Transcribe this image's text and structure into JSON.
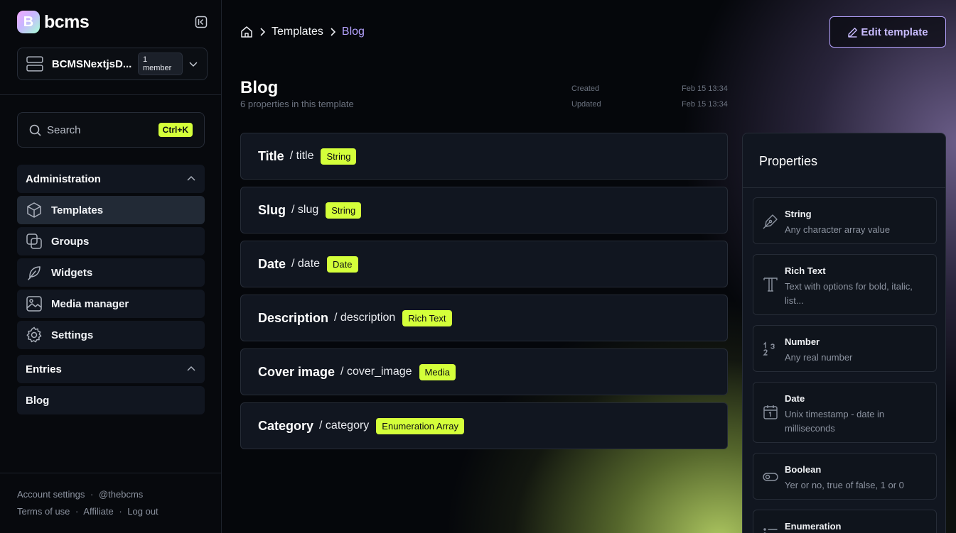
{
  "brand": {
    "name": "bcms",
    "logo_letter": "B"
  },
  "workspace": {
    "name": "BCMSNextjsD...",
    "members": "1 member"
  },
  "search": {
    "label": "Search",
    "shortcut": "Ctrl+K"
  },
  "sidebar": {
    "administration_label": "Administration",
    "admin_items": [
      {
        "label": "Templates",
        "icon": "cube-icon",
        "active": true
      },
      {
        "label": "Groups",
        "icon": "groups-icon",
        "active": false
      },
      {
        "label": "Widgets",
        "icon": "feather-icon",
        "active": false
      },
      {
        "label": "Media manager",
        "icon": "image-icon",
        "active": false
      },
      {
        "label": "Settings",
        "icon": "gear-icon",
        "active": false
      }
    ],
    "entries_label": "Entries",
    "entries_items": [
      {
        "label": "Blog"
      }
    ]
  },
  "footer": {
    "account_settings": "Account settings",
    "handle": "@thebcms",
    "terms": "Terms of use",
    "affiliate": "Affiliate",
    "logout": "Log out",
    "separator": "·"
  },
  "breadcrumb": {
    "items": [
      "Templates"
    ],
    "current": "Blog",
    "separator_icon": "chevron-right-icon"
  },
  "toolbar": {
    "edit_label": "Edit template"
  },
  "template": {
    "title": "Blog",
    "subtitle": "6 properties in this template",
    "created_label": "Created",
    "created_value": "Feb 15 13:34",
    "updated_label": "Updated",
    "updated_value": "Feb 15 13:34"
  },
  "properties": [
    {
      "label": "Title",
      "key": "/ title",
      "type": "String"
    },
    {
      "label": "Slug",
      "key": "/ slug",
      "type": "String"
    },
    {
      "label": "Date",
      "key": "/ date",
      "type": "Date"
    },
    {
      "label": "Description",
      "key": "/ description",
      "type": "Rich Text"
    },
    {
      "label": "Cover image",
      "key": "/ cover_image",
      "type": "Media"
    },
    {
      "label": "Category",
      "key": "/ category",
      "type": "Enumeration Array"
    }
  ],
  "properties_panel": {
    "title": "Properties",
    "items": [
      {
        "name": "String",
        "desc": "Any character array value",
        "icon": "pen-nib-icon"
      },
      {
        "name": "Rich Text",
        "desc": "Text with options for bold, italic, list...",
        "icon": "rich-text-icon"
      },
      {
        "name": "Number",
        "desc": "Any real number",
        "icon": "number-icon"
      },
      {
        "name": "Date",
        "desc": "Unix timestamp - date in milliseconds",
        "icon": "calendar-icon"
      },
      {
        "name": "Boolean",
        "desc": "Yer or no, true of false, 1 or 0",
        "icon": "toggle-icon"
      },
      {
        "name": "Enumeration",
        "desc": "",
        "icon": "list-icon"
      }
    ]
  },
  "colors": {
    "accent_lime": "#d4ff3a",
    "accent_purple": "#b5a3ff",
    "panel": "#111620"
  }
}
